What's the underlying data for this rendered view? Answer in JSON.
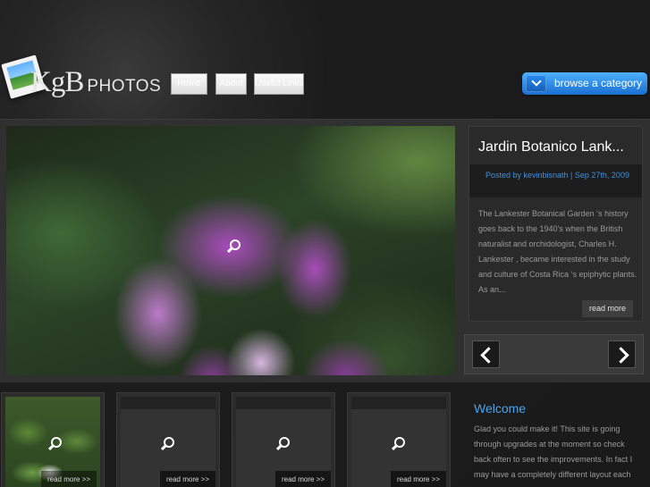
{
  "header": {
    "logo": {
      "kgb": "KgB",
      "photos": "PHOTOS"
    },
    "nav": {
      "home": "Home",
      "about": "About",
      "links": "Useful Links"
    },
    "browse_label": "browse a category"
  },
  "featured": {
    "title": "Jardin Botanico Lank...",
    "meta": "Posted by kevinbisnath | Sep 27th, 2009",
    "excerpt": "The Lankester Botanical Garden ‘s history goes back to the 1940’s when the British naturalist and orchidologist, Charles H. Lankester , became interested in the study and culture of Costa Rica ‘s epiphytic plants. As an...",
    "read_more": "read more"
  },
  "thumbnails": [
    {
      "read_more": "read more >>"
    },
    {
      "read_more": "read more >>"
    },
    {
      "read_more": "read more >>"
    },
    {
      "read_more": "read more >>"
    }
  ],
  "welcome": {
    "title": "Welcome",
    "text": "Glad you could make it! This site is going through upgrades at the moment so check back often to see the improvements. In fact I may have a completely different layout each"
  },
  "colors": {
    "accent": "#4ba3ea",
    "browse_button": "#1a6fd0",
    "background": "#1b1b1b"
  },
  "icons": [
    "magnifier-icon",
    "chevron-down-icon",
    "arrow-left-icon",
    "arrow-right-icon"
  ]
}
